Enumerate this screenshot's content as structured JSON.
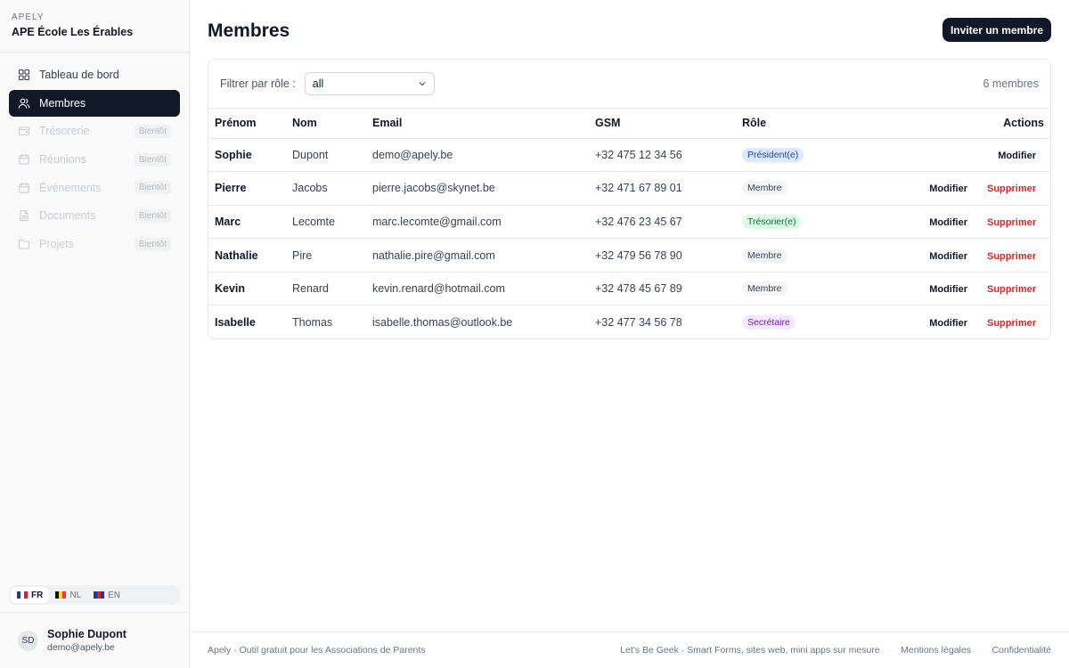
{
  "brand": {
    "app": "APELY",
    "org": "APE École Les Érables"
  },
  "nav": [
    {
      "label": "Tableau de bord",
      "icon": "dashboard-icon",
      "state": "normal",
      "badge": ""
    },
    {
      "label": "Membres",
      "icon": "users-icon",
      "state": "active",
      "badge": ""
    },
    {
      "label": "Trésorerie",
      "icon": "wallet-icon",
      "state": "disabled",
      "badge": "Bientôt"
    },
    {
      "label": "Réunions",
      "icon": "calendar-icon",
      "state": "disabled",
      "badge": "Bientôt"
    },
    {
      "label": "Événements",
      "icon": "calendar-icon",
      "state": "disabled",
      "badge": "Bientôt"
    },
    {
      "label": "Documents",
      "icon": "document-icon",
      "state": "disabled",
      "badge": "Bientôt"
    },
    {
      "label": "Projets",
      "icon": "folder-icon",
      "state": "disabled",
      "badge": "Bientôt"
    }
  ],
  "languages": [
    {
      "code": "FR",
      "active": true
    },
    {
      "code": "NL",
      "active": false
    },
    {
      "code": "EN",
      "active": false
    }
  ],
  "user": {
    "initials": "SD",
    "name": "Sophie Dupont",
    "email": "demo@apely.be"
  },
  "header": {
    "title": "Membres",
    "invite_label": "Inviter un membre"
  },
  "filter": {
    "label": "Filtrer par rôle :",
    "value": "all",
    "count": "6 membres"
  },
  "table": {
    "columns": [
      "Prénom",
      "Nom",
      "Email",
      "GSM",
      "Rôle",
      "Actions"
    ],
    "edit_label": "Modifier",
    "delete_label": "Supprimer",
    "rows": [
      {
        "first": "Sophie",
        "last": "Dupont",
        "email": "demo@apely.be",
        "phone": "+32 475 12 34 56",
        "role": "Président(e)",
        "role_bg": "#dbeafe",
        "role_color": "#1e40af",
        "can_delete": false
      },
      {
        "first": "Pierre",
        "last": "Jacobs",
        "email": "pierre.jacobs@skynet.be",
        "phone": "+32 471 67 89 01",
        "role": "Membre",
        "role_bg": "#f3f4f6",
        "role_color": "#374151",
        "can_delete": true
      },
      {
        "first": "Marc",
        "last": "Lecomte",
        "email": "marc.lecomte@gmail.com",
        "phone": "+32 476 23 45 67",
        "role": "Trésorier(e)",
        "role_bg": "#dcfce7",
        "role_color": "#166534",
        "can_delete": true
      },
      {
        "first": "Nathalie",
        "last": "Pire",
        "email": "nathalie.pire@gmail.com",
        "phone": "+32 479 56 78 90",
        "role": "Membre",
        "role_bg": "#f3f4f6",
        "role_color": "#374151",
        "can_delete": true
      },
      {
        "first": "Kevin",
        "last": "Renard",
        "email": "kevin.renard@hotmail.com",
        "phone": "+32 478 45 67 89",
        "role": "Membre",
        "role_bg": "#f3f4f6",
        "role_color": "#374151",
        "can_delete": true
      },
      {
        "first": "Isabelle",
        "last": "Thomas",
        "email": "isabelle.thomas@outlook.be",
        "phone": "+32 477 34 56 78",
        "role": "Secrétaire",
        "role_bg": "#f3e8ff",
        "role_color": "#6b21a8",
        "can_delete": true
      }
    ]
  },
  "footer": {
    "left": "Apely · Outil gratuit pour les Associations de Parents",
    "link1": "Let's Be Geek · Smart Forms, sites web, mini apps sur mesure",
    "separator": "·",
    "link2": "Mentions légales",
    "link3": "Confidentialité"
  }
}
